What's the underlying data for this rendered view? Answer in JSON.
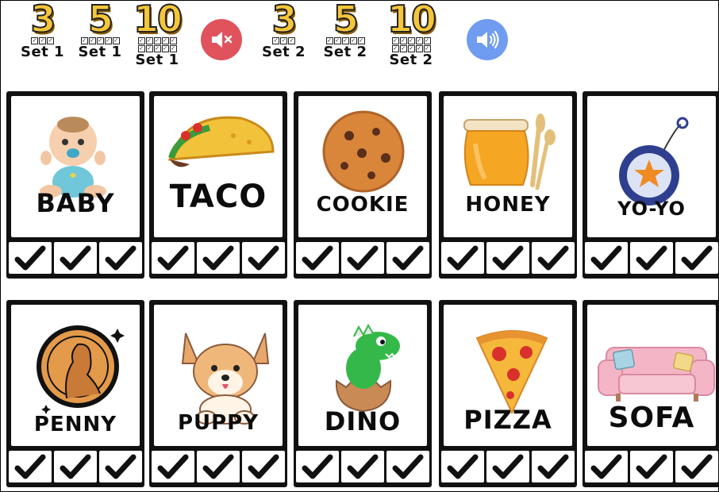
{
  "toolbar": {
    "set_buttons": [
      {
        "number": "3",
        "label": "Set 1",
        "checks": 3
      },
      {
        "number": "5",
        "label": "Set 1",
        "checks": 5
      },
      {
        "number": "10",
        "label": "Set 1",
        "checks": 10
      },
      {
        "number": "3",
        "label": "Set 2",
        "checks": 3
      },
      {
        "number": "5",
        "label": "Set 2",
        "checks": 5
      },
      {
        "number": "10",
        "label": "Set 2",
        "checks": 10
      }
    ],
    "mute_button": {
      "icon": "speaker-muted-icon",
      "color": "#e0535c"
    },
    "sound_button": {
      "icon": "speaker-on-icon",
      "color": "#6f9cf0"
    }
  },
  "cards": [
    {
      "word": "BABY",
      "icon": "baby-icon"
    },
    {
      "word": "TACO",
      "icon": "taco-icon"
    },
    {
      "word": "COOKIE",
      "icon": "cookie-icon"
    },
    {
      "word": "HONEY",
      "icon": "honey-jar-icon"
    },
    {
      "word": "YO-YO",
      "icon": "yoyo-icon"
    },
    {
      "word": "PENNY",
      "icon": "penny-coin-icon"
    },
    {
      "word": "PUPPY",
      "icon": "puppy-icon"
    },
    {
      "word": "DINO",
      "icon": "dinosaur-icon"
    },
    {
      "word": "PIZZA",
      "icon": "pizza-slice-icon"
    },
    {
      "word": "SOFA",
      "icon": "sofa-icon"
    }
  ],
  "check_glyph": "✔",
  "colors": {
    "card_border": "#111111",
    "set_number": "#f5c53a"
  }
}
